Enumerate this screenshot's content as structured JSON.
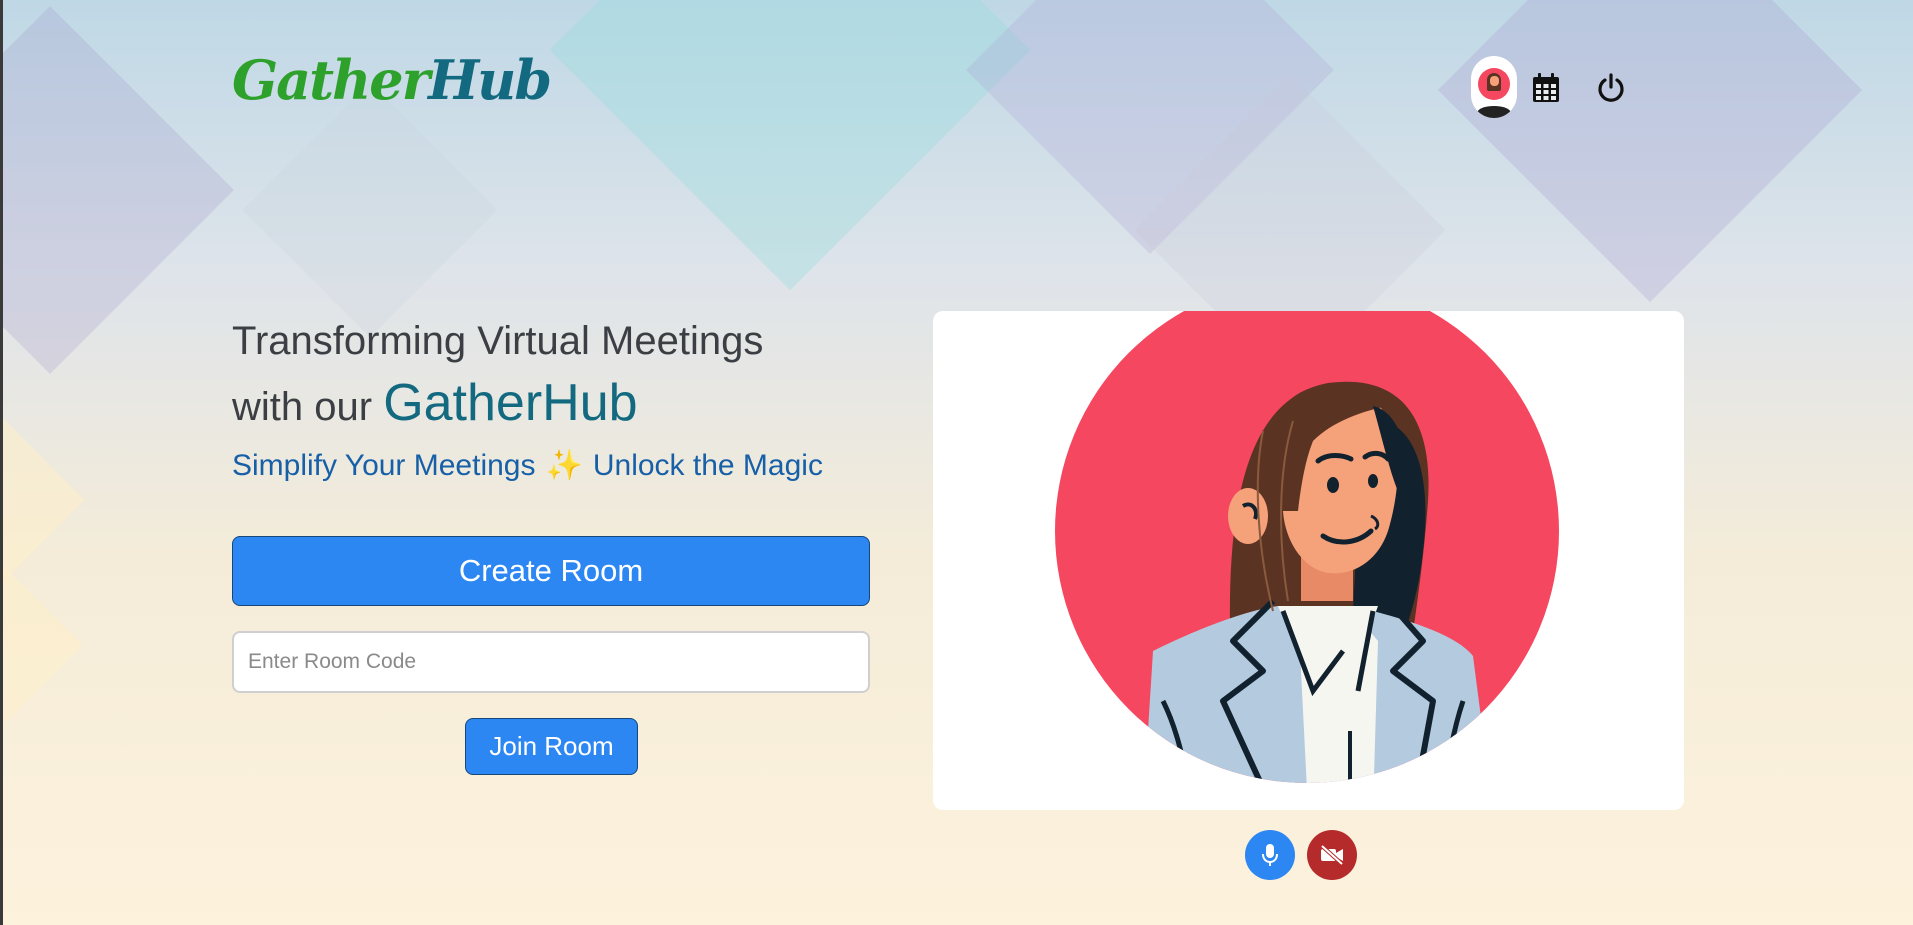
{
  "header": {
    "logo_part1": "Gather",
    "logo_part2": "Hub"
  },
  "hero": {
    "title_line1": "Transforming Virtual Meetings",
    "title_line2_prefix": "with our",
    "title_brand": "GatherHub",
    "tagline_part1": "Simplify Your Meetings",
    "tagline_sparkle": "✨",
    "tagline_part2": "Unlock the Magic"
  },
  "actions": {
    "create_room_label": "Create Room",
    "room_code_placeholder": "Enter Room Code",
    "room_code_value": "",
    "join_room_label": "Join Room"
  },
  "preview": {
    "mic_state": "on",
    "camera_state": "off"
  },
  "icons": {
    "avatar": "user-avatar-icon",
    "calendar": "calendar-icon",
    "power": "power-icon",
    "mic": "microphone-icon",
    "camera_off": "video-off-icon"
  },
  "colors": {
    "primary_button": "#2d87f3",
    "camera_off": "#b52a2a",
    "logo_green": "#2ea12c",
    "logo_teal": "#136a80",
    "tagline": "#1760a8",
    "avatar_circle": "#f5475f"
  }
}
